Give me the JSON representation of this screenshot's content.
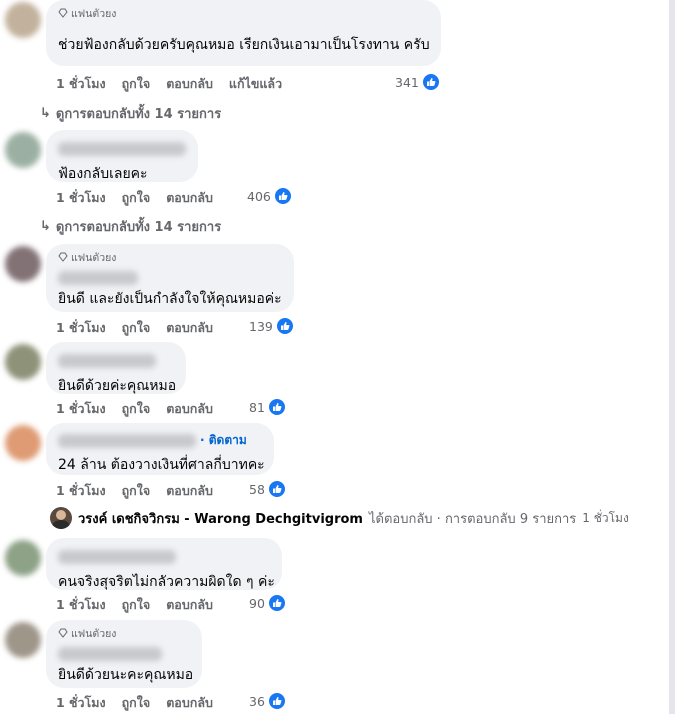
{
  "fan_badge": "แฟนตัวยง",
  "like_label": "ถูกใจ",
  "reply_label": "ตอบกลับ",
  "colors": {
    "like_blue": "#1877f2",
    "bubble_bg": "#f0f2f5",
    "meta_gray": "#65676b"
  },
  "comments": [
    {
      "badge": true,
      "text": "ช่วยฟ้องกลับด้วยครับคุณหมอ เรียกเงินเอามาเป็นโรงทาน ครับ",
      "time": "1 ชั่วโมง",
      "edited": "แก้ไขแล้ว",
      "reactions": "341"
    },
    {
      "text": "ฟ้องกลับเลยคะ",
      "time": "1 ชั่วโมง",
      "reactions": "406"
    },
    {
      "badge": true,
      "text": "ยินดี และยังเป็นกำลังใจให้คุณหมอค่ะ",
      "time": "1 ชั่วโมง",
      "reactions": "139"
    },
    {
      "text": "ยินดีด้วยค่ะคุณหมอ",
      "time": "1 ชั่วโมง",
      "reactions": "81"
    },
    {
      "follow": "ติดตาม",
      "text": "24 ล้าน ต้องวางเงินที่ศาลกี่บาทคะ",
      "time": "1 ชั่วโมง",
      "reactions": "58"
    },
    {
      "text": "คนจริงสุจริตไม่กลัวความผิดใด ๆ ค่ะ",
      "time": "1 ชั่วโมง",
      "reactions": "90"
    },
    {
      "badge": true,
      "text": "ยินดีด้วยนะคะคุณหมอ",
      "time": "1 ชั่วโมง",
      "reactions": "36"
    }
  ],
  "view_replies": [
    {
      "label": "ดูการตอบกลับทั้ง 14 รายการ"
    },
    {
      "label": "ดูการตอบกลับทั้ง 14 รายการ"
    }
  ],
  "reply_summary": {
    "name": "วรงค์ เดชกิจวิกรม - Warong Dechgitvigrom",
    "text": "ได้ตอบกลับ · การตอบกลับ 9 รายการ",
    "time": "1 ชั่วโมง"
  }
}
